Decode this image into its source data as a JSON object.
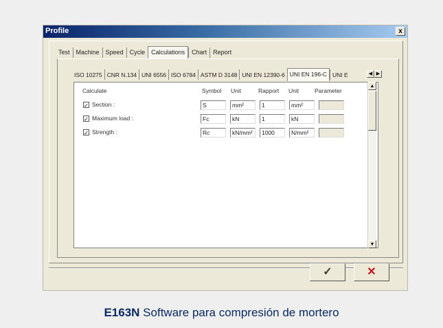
{
  "window": {
    "title": "Profile",
    "close_symbol": "x"
  },
  "top_tabs": [
    "Test",
    "Machine",
    "Speed",
    "Cycle",
    "Calculations",
    "Chart",
    "Report"
  ],
  "top_tabs_active": "Calculations",
  "standard_tabs": [
    "ISO 10275",
    "CNR N.134",
    "UNI 6556",
    "ISO 6784",
    "ASTM D 3148",
    "UNI EN 12390-6",
    "UNI EN 196-C",
    "UNI E"
  ],
  "standard_tabs_active": "UNI EN 196-C",
  "table": {
    "headers": {
      "calculate": "Calculate",
      "symbol": "Symbol",
      "unit": "Unit",
      "rapport": "Rapport",
      "unit2": "Unit",
      "parameter": "Parameter"
    },
    "rows": [
      {
        "checked": true,
        "label": "Section :",
        "symbol": "S",
        "unit": "mm²",
        "rapport": "1",
        "unit2": "mm²",
        "parameter": ""
      },
      {
        "checked": true,
        "label": "Maximum load :",
        "symbol": "Fc",
        "unit": "kN",
        "rapport": "1",
        "unit2": "kN",
        "parameter": ""
      },
      {
        "checked": true,
        "label": "Strength :",
        "symbol": "Rc",
        "unit": "kN/mm²",
        "rapport": "1000",
        "unit2": "N/mm²",
        "parameter": ""
      }
    ]
  },
  "buttons": {
    "ok_symbol": "✓",
    "cancel_symbol": "✕"
  },
  "caption": {
    "code": "E163N",
    "text": "Software para compresión de mortero"
  },
  "colors": {
    "accent": "#0a2a63",
    "cancel": "#c0141c",
    "ok": "#3a3a3a"
  }
}
